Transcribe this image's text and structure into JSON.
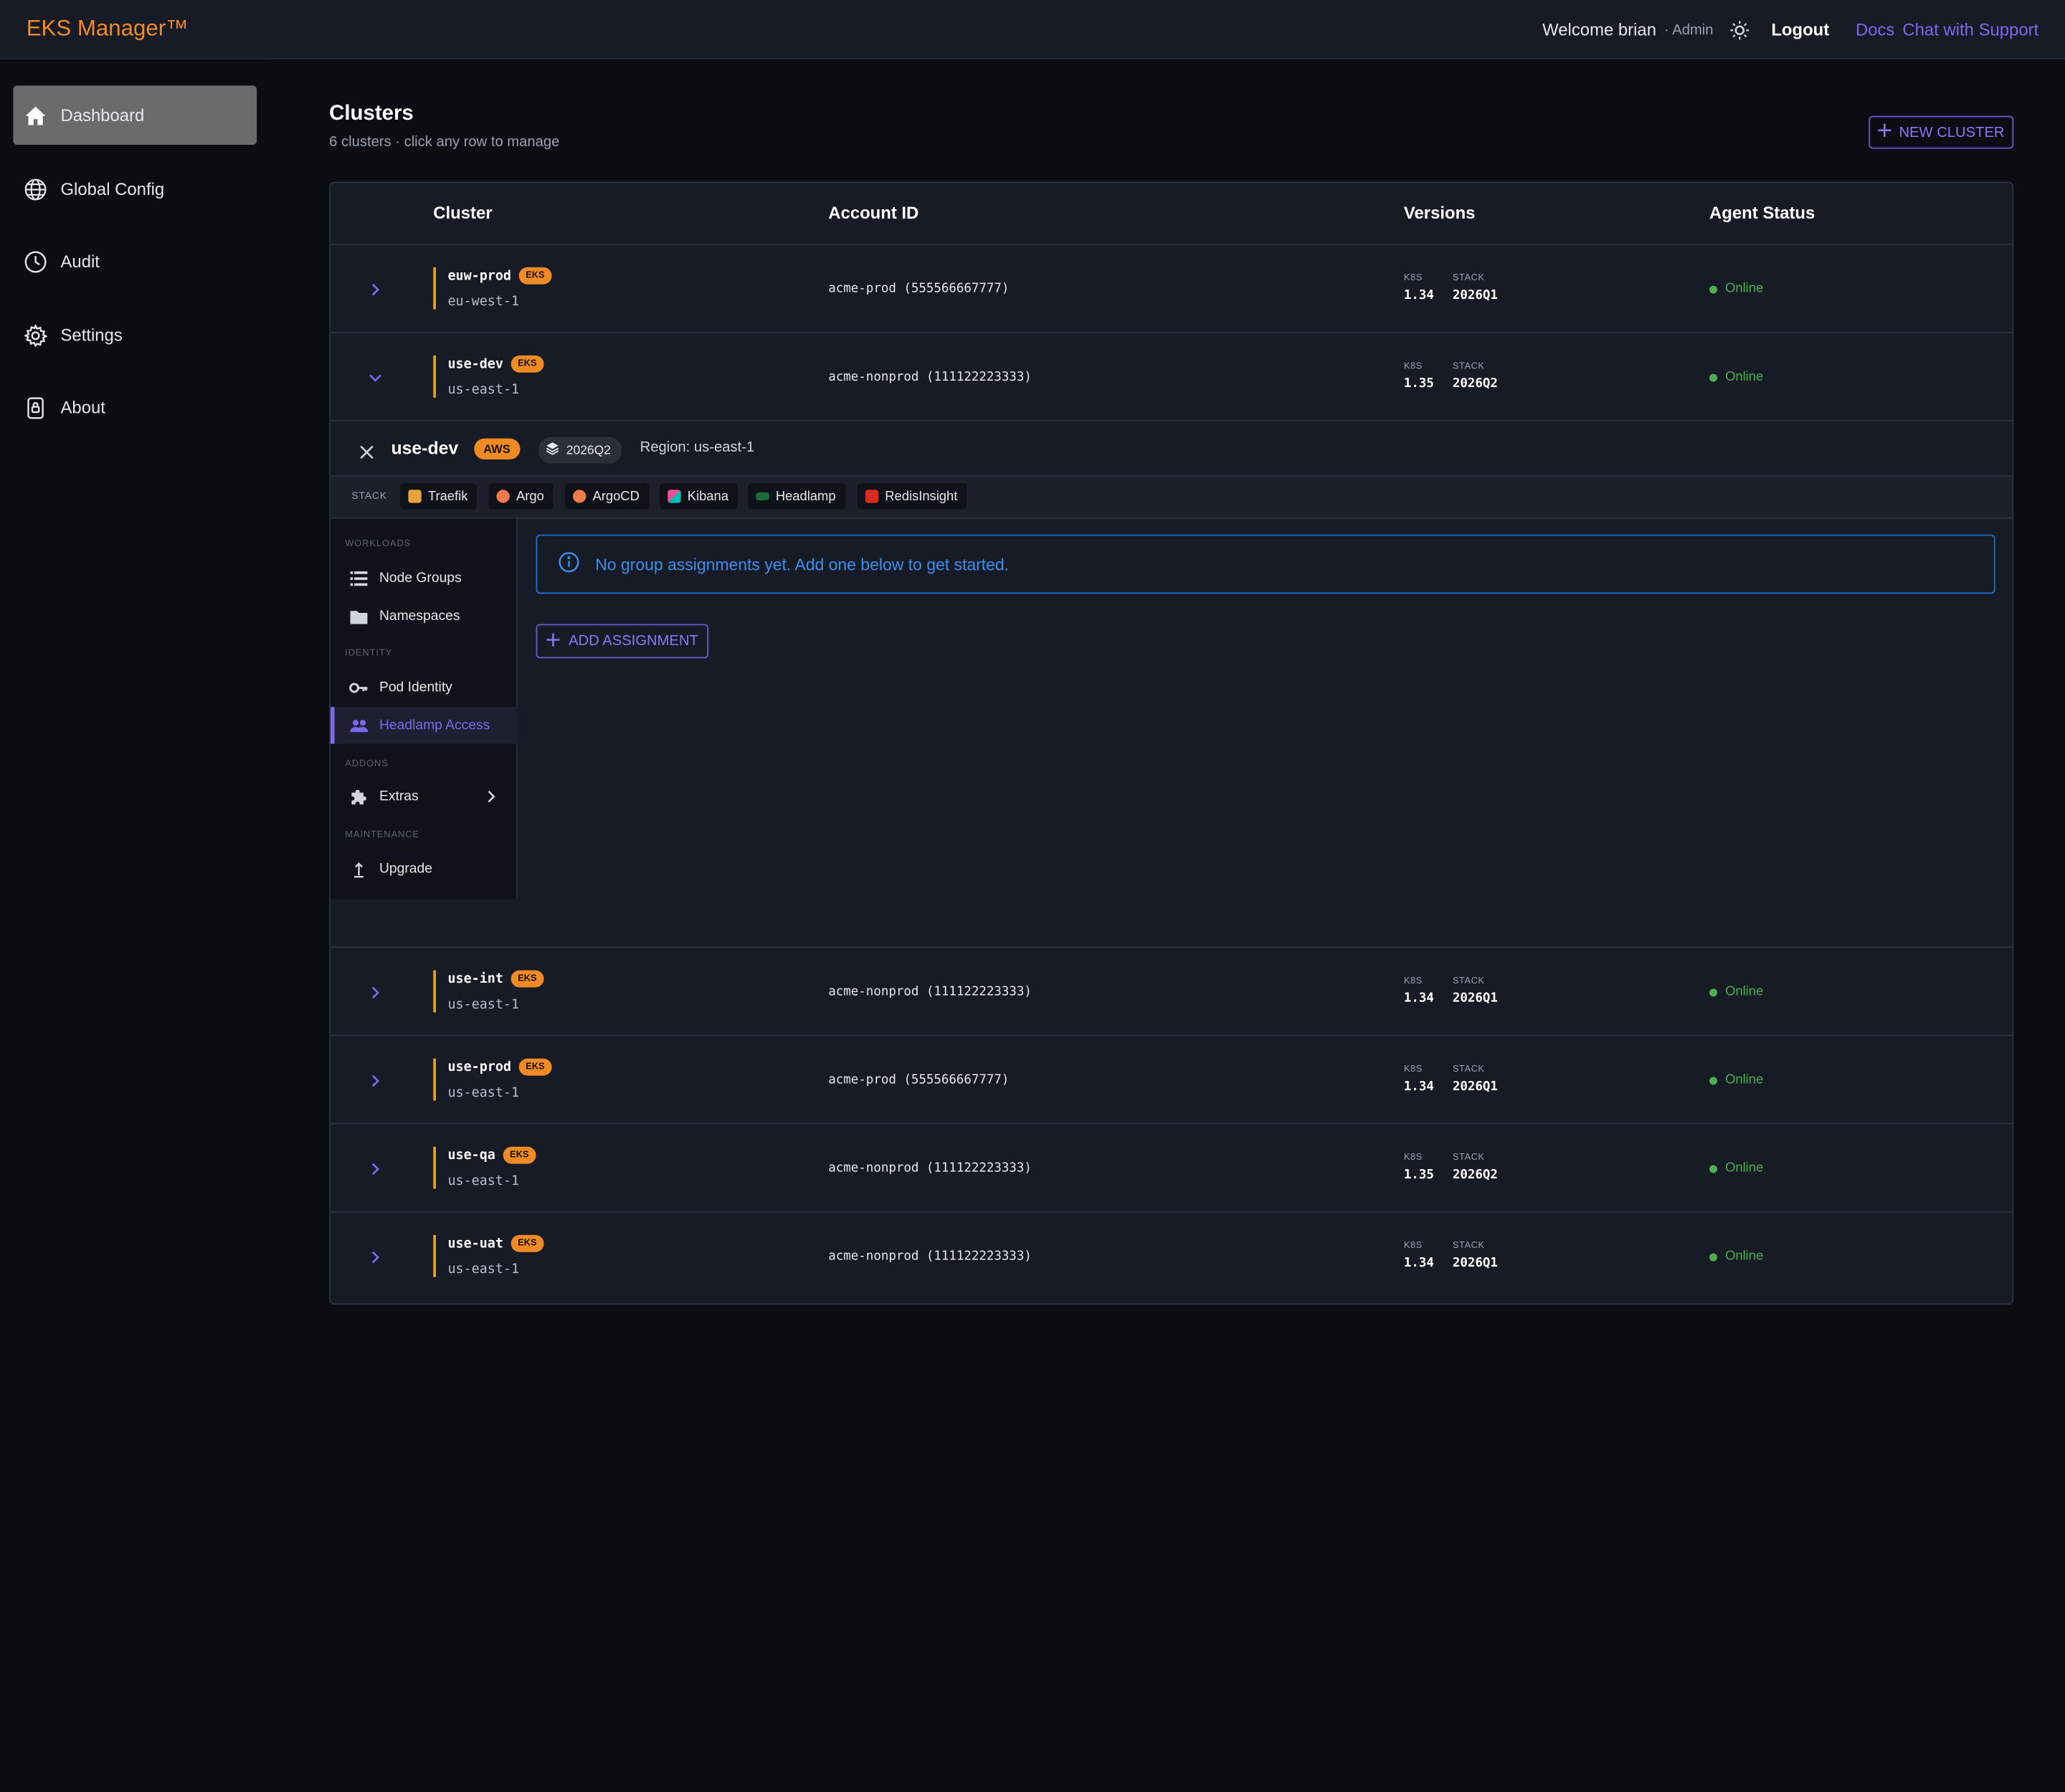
{
  "app": {
    "brand": "EKS Manager™"
  },
  "topbar": {
    "welcome": "Welcome brian",
    "role": "· Admin",
    "logout": "Logout",
    "docs": "Docs",
    "support": "Chat with Support"
  },
  "sidebar": {
    "items": [
      {
        "label": "Dashboard",
        "icon": "home-icon",
        "active": true
      },
      {
        "label": "Global Config",
        "icon": "globe-icon"
      },
      {
        "label": "Audit",
        "icon": "clock-icon"
      },
      {
        "label": "Settings",
        "icon": "gear-icon"
      },
      {
        "label": "About",
        "icon": "lock-icon"
      }
    ]
  },
  "page": {
    "title": "Clusters",
    "subtitle": "6 clusters · click any row to manage",
    "new_button": "NEW CLUSTER"
  },
  "table": {
    "headers": [
      "Cluster",
      "Account ID",
      "Versions",
      "Agent Status"
    ],
    "k8s_label": "K8S",
    "stack_label": "STACK",
    "eks_badge": "EKS",
    "rows": [
      {
        "name": "euw-prod",
        "region": "eu-west-1",
        "account": "acme-prod (555566667777)",
        "k8s": "1.34",
        "stack": "2026Q1",
        "status": "Online",
        "expanded": false
      },
      {
        "name": "use-dev",
        "region": "us-east-1",
        "account": "acme-nonprod (111122223333)",
        "k8s": "1.35",
        "stack": "2026Q2",
        "status": "Online",
        "expanded": true
      },
      {
        "name": "use-int",
        "region": "us-east-1",
        "account": "acme-nonprod (111122223333)",
        "k8s": "1.34",
        "stack": "2026Q1",
        "status": "Online",
        "expanded": false
      },
      {
        "name": "use-prod",
        "region": "us-east-1",
        "account": "acme-prod (555566667777)",
        "k8s": "1.34",
        "stack": "2026Q1",
        "status": "Online",
        "expanded": false
      },
      {
        "name": "use-qa",
        "region": "us-east-1",
        "account": "acme-nonprod (111122223333)",
        "k8s": "1.35",
        "stack": "2026Q2",
        "status": "Online",
        "expanded": false
      },
      {
        "name": "use-uat",
        "region": "us-east-1",
        "account": "acme-nonprod (111122223333)",
        "k8s": "1.34",
        "stack": "2026Q1",
        "status": "Online",
        "expanded": false
      }
    ]
  },
  "detail": {
    "name": "use-dev",
    "provider": "AWS",
    "stack": "2026Q2",
    "region": "Region: us-east-1",
    "stack_label": "STACK",
    "tools": [
      "Traefik",
      "Argo",
      "ArgoCD",
      "Kibana",
      "Headlamp",
      "RedisInsight"
    ],
    "nav": {
      "workloads": "WORKLOADS",
      "node_groups": "Node Groups",
      "namespaces": "Namespaces",
      "identity": "IDENTITY",
      "pod_identity": "Pod Identity",
      "headlamp_access": "Headlamp Access",
      "addons": "ADDONS",
      "extras": "Extras",
      "maintenance": "MAINTENANCE",
      "upgrade": "Upgrade"
    },
    "info": "No group assignments yet. Add one below to get started.",
    "add_button": "ADD ASSIGNMENT"
  },
  "colors": {
    "accent": "#7b68ee",
    "brand": "#f08a24",
    "online": "#4caf50",
    "info": "#3a8ff0"
  }
}
